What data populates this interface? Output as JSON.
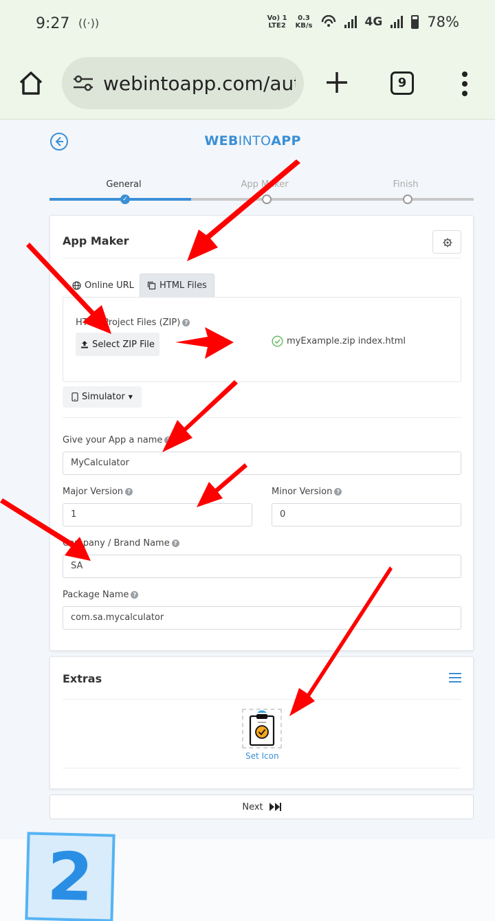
{
  "status_bar": {
    "time": "9:27",
    "hotspot_icon": "hotspot-icon",
    "volte": "Vo) 1",
    "lte": "LTE2",
    "speed_value": "0.3",
    "speed_unit": "KB/s",
    "network": "4G",
    "battery": "78%"
  },
  "browser": {
    "url": "webintoapp.com/aut",
    "tab_count": "9"
  },
  "header": {
    "brand_a": "WEB",
    "brand_b": "INTO",
    "brand_c": "APP"
  },
  "steps": [
    {
      "label": "General",
      "state": "done"
    },
    {
      "label": "App Maker",
      "state": "pending"
    },
    {
      "label": "Finish",
      "state": "pending"
    }
  ],
  "app_maker": {
    "title": "App Maker",
    "tabs": [
      {
        "label": "Online URL",
        "icon": "globe-icon"
      },
      {
        "label": "HTML Files",
        "icon": "copy-icon",
        "active": true
      }
    ],
    "zip_label": "HTML Project Files (ZIP)",
    "select_zip_label": "Select ZIP File",
    "selected_files": "myExample.zip index.html",
    "simulator_label": "Simulator",
    "app_name_label": "Give your App a name",
    "app_name_value": "MyCalculator",
    "major_label": "Major Version",
    "major_value": "1",
    "minor_label": "Minor Version",
    "minor_value": "0",
    "company_label": "Company / Brand Name",
    "company_value": "SA",
    "package_label": "Package Name",
    "package_value": "com.sa.mycalculator"
  },
  "extras": {
    "title": "Extras",
    "set_icon_label": "Set Icon"
  },
  "next_label": "Next",
  "step_badge": "2",
  "colors": {
    "accent": "#3a8fd6",
    "arrow": "#ff0000",
    "badge_border": "#55b3f4"
  }
}
